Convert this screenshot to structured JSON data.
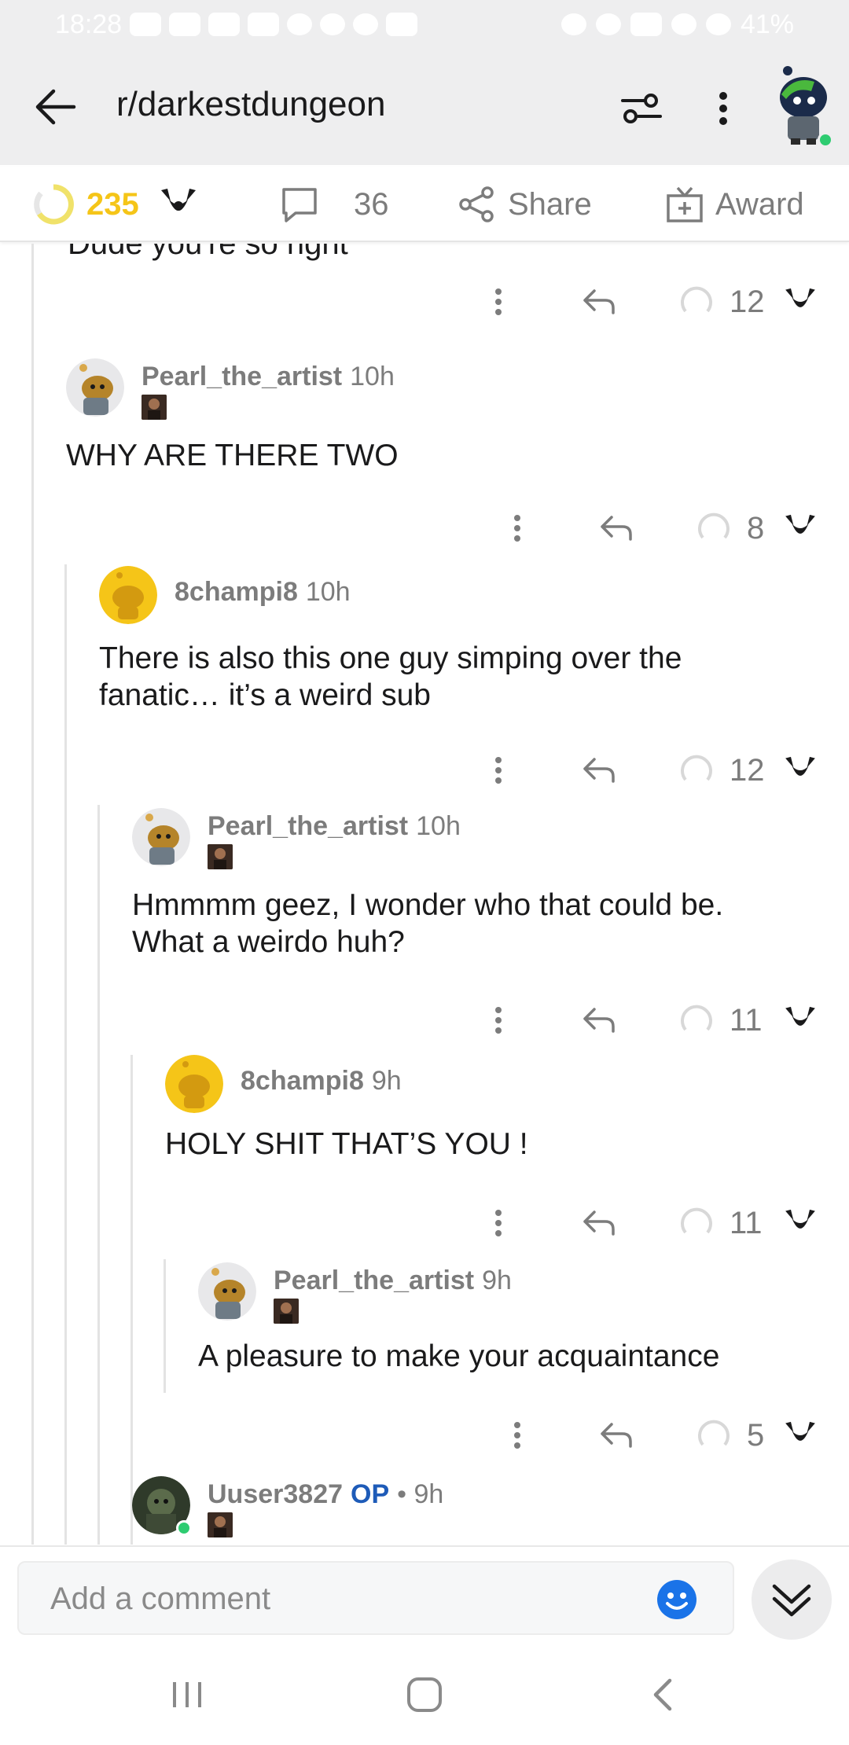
{
  "status_bar": {
    "time": "18:28",
    "battery": "41%"
  },
  "header": {
    "subreddit": "r/darkestdungeon"
  },
  "post_bar": {
    "score": "235",
    "comment_count": "36",
    "share_label": "Share",
    "award_label": "Award"
  },
  "cut_off_text": "Dude you're so right",
  "action_rows": [
    {
      "score": "12"
    },
    {
      "score": "8"
    },
    {
      "score": "12"
    },
    {
      "score": "11"
    },
    {
      "score": "11"
    },
    {
      "score": "5"
    }
  ],
  "comments": [
    {
      "user": "Pearl_the_artist",
      "time": "10h",
      "body_lines": [
        "WHY ARE THERE TWO"
      ]
    },
    {
      "user": "8champi8",
      "time": "10h",
      "body_lines": [
        "There is also this one guy simping over the",
        "fanatic… it’s a weird sub"
      ]
    },
    {
      "user": "Pearl_the_artist",
      "time": "10h",
      "body_lines": [
        "Hmmmm geez, I wonder who that could be.",
        "What a weirdo huh?"
      ]
    },
    {
      "user": "8champi8",
      "time": "9h",
      "body_lines": [
        "HOLY SHIT THAT’S YOU !"
      ]
    },
    {
      "user": "Pearl_the_artist",
      "time": "9h",
      "body_lines": [
        "A pleasure to make your acquaintance"
      ]
    },
    {
      "user": "Uuser3827",
      "op": "OP",
      "time": "• 9h",
      "body_lines": []
    }
  ],
  "composer": {
    "placeholder": "Add a comment"
  },
  "colors": {
    "upvote_gold": "#f5c518",
    "op_blue": "#1e5bb8",
    "online_green": "#2ecc71",
    "emoji_blue": "#1a73e8"
  },
  "icons": [
    "back-arrow-icon",
    "filter-icon",
    "more-vertical-icon",
    "upvote-icon",
    "downvote-icon",
    "comment-icon",
    "share-icon",
    "award-icon",
    "reply-icon",
    "emoji-icon",
    "chevron-double-down-icon"
  ]
}
